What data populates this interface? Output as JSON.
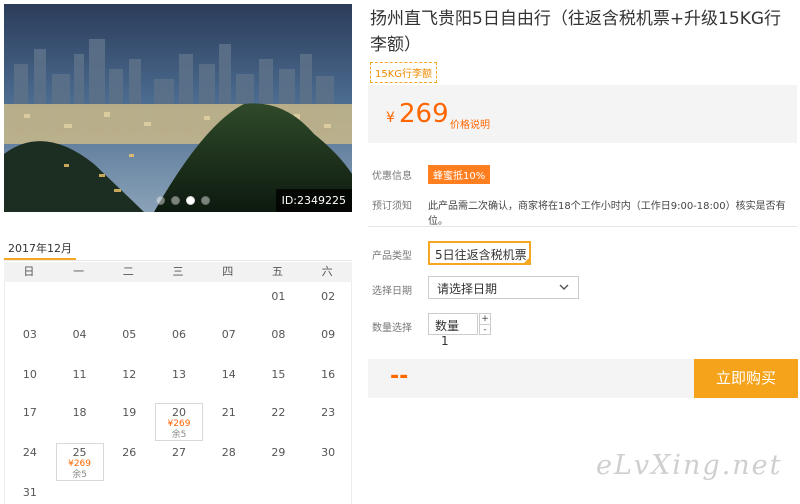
{
  "hero": {
    "image_id": "ID:2349225",
    "slide_count": 4,
    "active_slide": 3
  },
  "product": {
    "title": "扬州直飞贵阳5日自由行（往返含税机票+升级15KG行李额）",
    "luggage_tag": "15KG行李额",
    "price_currency": "¥",
    "price": "269",
    "price_note": "价格说明"
  },
  "info": {
    "coupon_label": "优惠信息",
    "coupon_value": "蜂蜜抵10%",
    "notice_label": "预订须知",
    "notice_text": "此产品需二次确认，商家将在18个工作小时内（工作日9:00-18:00）核实是否有位。"
  },
  "options": {
    "type_label": "产品类型",
    "type_value": "5日往返含税机票",
    "date_label": "选择日期",
    "date_placeholder": "请选择日期",
    "qty_label": "数量选择",
    "qty_text": "数量",
    "qty_value": "1",
    "qty_plus": "+",
    "qty_minus": "-"
  },
  "buy": {
    "total": "--",
    "button_label": "立即购买"
  },
  "calendar": {
    "month": "2017年12月",
    "weekdays": [
      "日",
      "一",
      "二",
      "三",
      "四",
      "五",
      "六"
    ],
    "days": [
      {
        "day": "01",
        "price": "",
        "stock": ""
      },
      {
        "day": "02",
        "price": "",
        "stock": ""
      },
      {
        "day": "03",
        "price": "",
        "stock": ""
      },
      {
        "day": "04",
        "price": "",
        "stock": ""
      },
      {
        "day": "05",
        "price": "",
        "stock": ""
      },
      {
        "day": "06",
        "price": "",
        "stock": ""
      },
      {
        "day": "07",
        "price": "",
        "stock": ""
      },
      {
        "day": "08",
        "price": "",
        "stock": ""
      },
      {
        "day": "09",
        "price": "",
        "stock": ""
      },
      {
        "day": "10",
        "price": "",
        "stock": ""
      },
      {
        "day": "11",
        "price": "",
        "stock": ""
      },
      {
        "day": "12",
        "price": "",
        "stock": ""
      },
      {
        "day": "13",
        "price": "",
        "stock": ""
      },
      {
        "day": "14",
        "price": "",
        "stock": ""
      },
      {
        "day": "15",
        "price": "",
        "stock": ""
      },
      {
        "day": "16",
        "price": "",
        "stock": ""
      },
      {
        "day": "17",
        "price": "",
        "stock": ""
      },
      {
        "day": "18",
        "price": "",
        "stock": ""
      },
      {
        "day": "19",
        "price": "",
        "stock": ""
      },
      {
        "day": "20",
        "price": "¥269",
        "stock": "余5"
      },
      {
        "day": "21",
        "price": "",
        "stock": ""
      },
      {
        "day": "22",
        "price": "",
        "stock": ""
      },
      {
        "day": "23",
        "price": "",
        "stock": ""
      },
      {
        "day": "24",
        "price": "",
        "stock": ""
      },
      {
        "day": "25",
        "price": "¥269",
        "stock": "余5"
      },
      {
        "day": "26",
        "price": "",
        "stock": ""
      },
      {
        "day": "27",
        "price": "",
        "stock": ""
      },
      {
        "day": "28",
        "price": "",
        "stock": ""
      },
      {
        "day": "29",
        "price": "",
        "stock": ""
      },
      {
        "day": "30",
        "price": "",
        "stock": ""
      },
      {
        "day": "31",
        "price": "",
        "stock": ""
      }
    ]
  },
  "watermark": "eLvXing.net",
  "colors": {
    "accent": "#ff6600",
    "button": "#f5a31a",
    "tag_border": "#f5a623"
  }
}
